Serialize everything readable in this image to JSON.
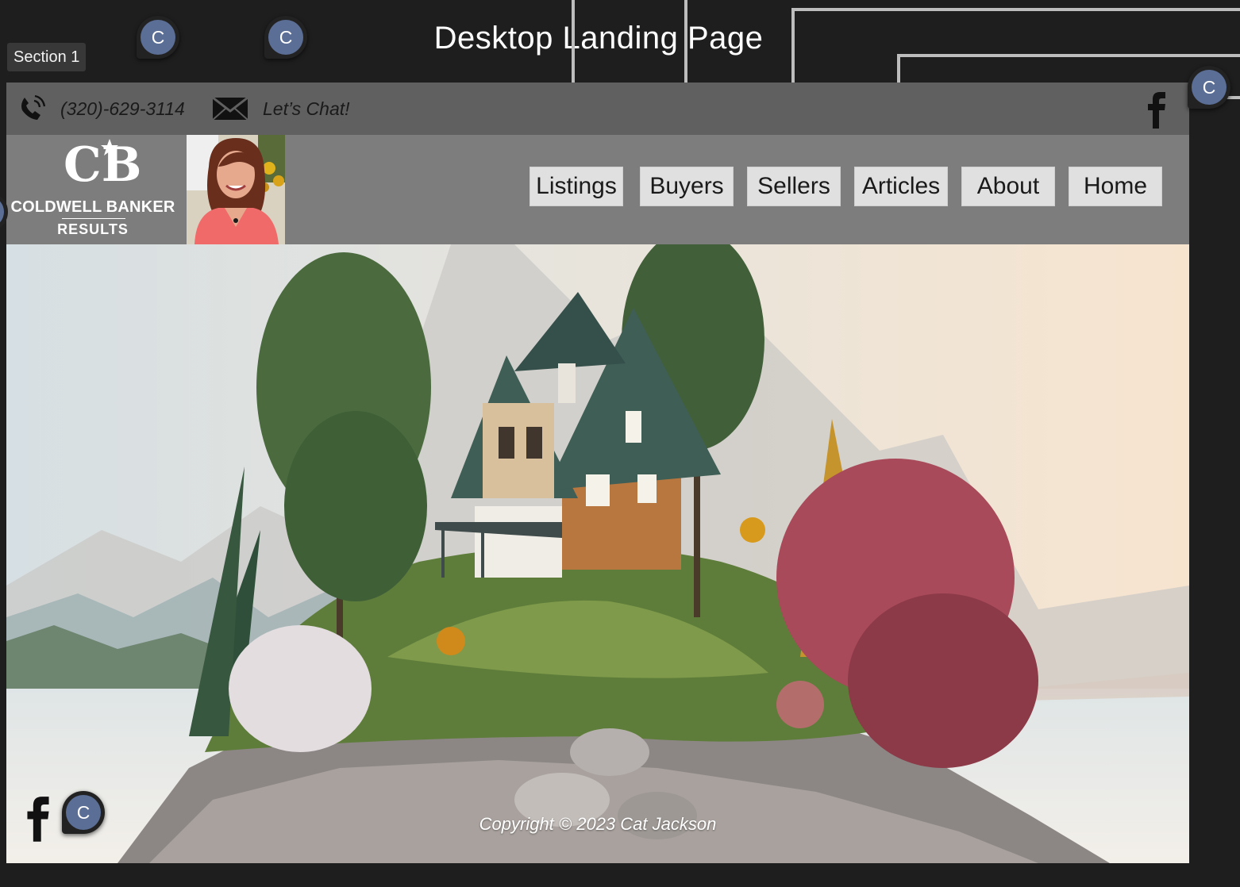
{
  "canvas": {
    "section_label": "Section 1",
    "frame_title": "Desktop Landing Page",
    "comment_marker": "C"
  },
  "topbar": {
    "phone": "(320)-629-3114",
    "chat": "Let’s Chat!",
    "social_icon": "facebook-icon"
  },
  "logo": {
    "monogram": "CB",
    "name": "COLDWELL BANKER",
    "subtitle": "RESULTS"
  },
  "nav": {
    "items": [
      {
        "label": "Listings"
      },
      {
        "label": "Buyers"
      },
      {
        "label": "Sellers"
      },
      {
        "label": "Articles"
      },
      {
        "label": "About"
      },
      {
        "label": "Home"
      }
    ]
  },
  "footer": {
    "copyright": "Copyright © 2023 Cat Jackson"
  },
  "colors": {
    "canvas_bg": "#1e1e1e",
    "topbar_bg": "#606060",
    "header_bg": "#7d7d7d",
    "nav_button_bg": "#e0e0e0",
    "comment_accent": "#5b6e95"
  }
}
